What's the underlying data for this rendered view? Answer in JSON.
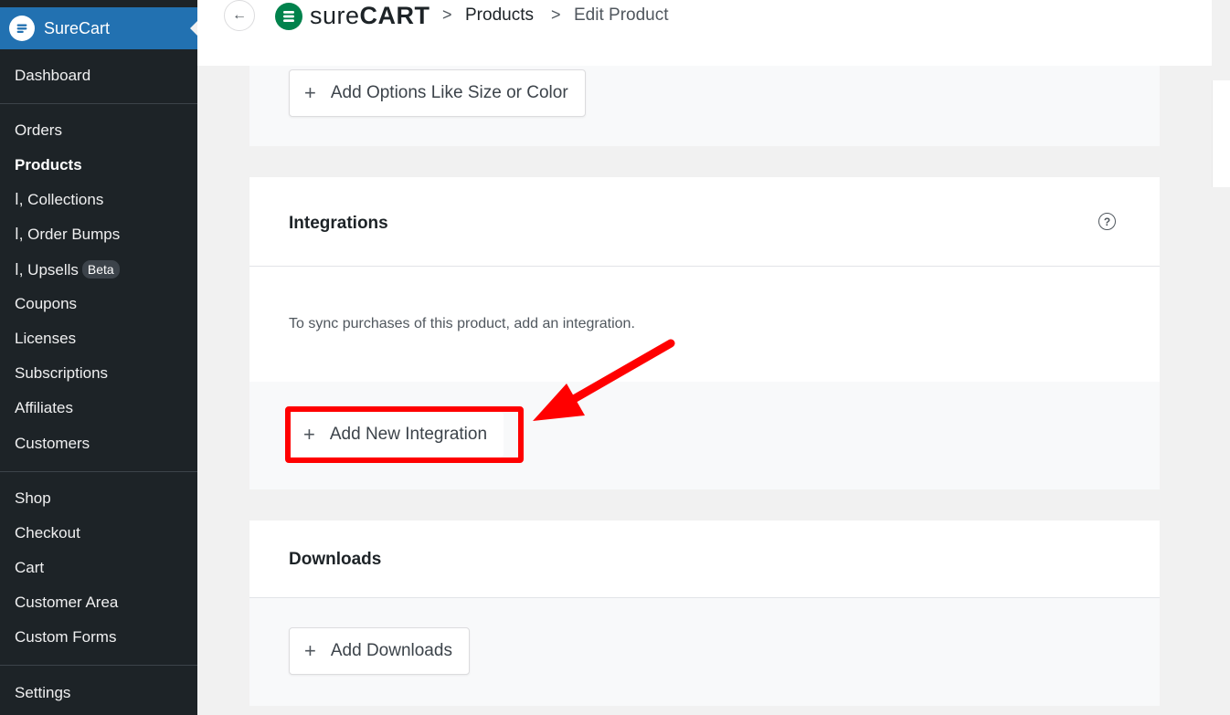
{
  "sidebar": {
    "brand": "SureCart",
    "items": [
      {
        "label": "Dashboard"
      },
      {
        "label": "Orders"
      },
      {
        "label": "Products"
      },
      {
        "label": "ⅼ, Collections"
      },
      {
        "label": "ⅼ, Order Bumps"
      },
      {
        "label": "ⅼ, Upsells",
        "badge": "Beta"
      },
      {
        "label": "Coupons"
      },
      {
        "label": "Licenses"
      },
      {
        "label": "Subscriptions"
      },
      {
        "label": "Affiliates"
      },
      {
        "label": "Customers"
      },
      {
        "label": "Shop"
      },
      {
        "label": "Checkout"
      },
      {
        "label": "Cart"
      },
      {
        "label": "Customer Area"
      },
      {
        "label": "Custom Forms"
      },
      {
        "label": "Settings"
      }
    ]
  },
  "header": {
    "logo_light": "sure",
    "logo_bold": "CART",
    "breadcrumb": [
      "Products",
      "Edit Product"
    ],
    "separator": ">"
  },
  "options": {
    "button_label": "Add Options Like Size or Color"
  },
  "integrations": {
    "title": "Integrations",
    "help": "?",
    "description": "To sync purchases of this product, add an integration.",
    "button_label": "Add New Integration"
  },
  "downloads": {
    "title": "Downloads",
    "button_label": "Add Downloads"
  },
  "plus": "+",
  "back_arrow": "←",
  "colors": {
    "sidebar_bg": "#1d2327",
    "brand_blue": "#2271b1",
    "surecart_green": "#01824c",
    "highlight_red": "#ff0000"
  }
}
